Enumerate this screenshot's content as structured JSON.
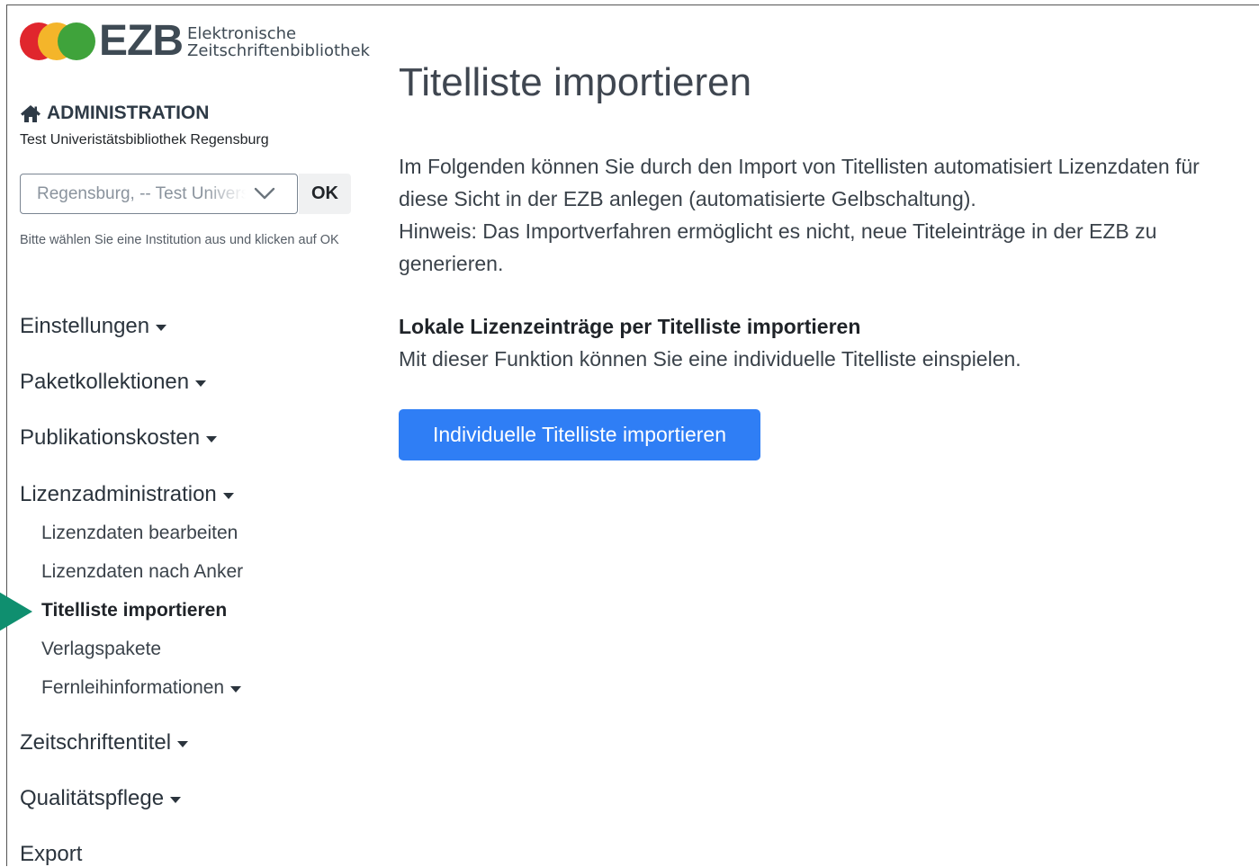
{
  "logo": {
    "wordmark": "EZB",
    "subtitle_line1": "Elektronische",
    "subtitle_line2": "Zeitschriftenbibliothek",
    "colors": [
      "#e0262d",
      "#f4b52a",
      "#3fa33b"
    ]
  },
  "sidebar": {
    "admin_title": "ADMINISTRATION",
    "institution_name": "Test Univeristätsbibliothek Regensburg",
    "institution_select_value": "Regensburg, -- Test Universitätsbibliothek Regensburg",
    "ok_label": "OK",
    "hint": "Bitte wählen Sie eine Institution aus und klicken auf OK",
    "nav": {
      "einstellungen": "Einstellungen",
      "paketkollektionen": "Paketkollektionen",
      "publikationskosten": "Publikationskosten",
      "lizenzadministration": "Lizenzadministration",
      "lizenzdaten_bearbeiten": "Lizenzdaten bearbeiten",
      "lizenzdaten_nach_anker": "Lizenzdaten nach Anker",
      "titelliste_importieren": "Titelliste importieren",
      "verlagspakete": "Verlagspakete",
      "fernleihinformationen": "Fernleihinformationen",
      "zeitschriftentitel": "Zeitschriftentitel",
      "qualitaetspflege": "Qualitätspflege",
      "export": "Export"
    },
    "active_marker_color": "#0f8f6f"
  },
  "main": {
    "title": "Titelliste importieren",
    "intro_paragraph": "Im Folgenden können Sie durch den Import von Titellisten automatisiert Lizenzdaten für diese Sicht in der EZB anlegen (automatisierte Gelbschaltung).",
    "intro_hint": "Hinweis: Das Importverfahren ermöglicht es nicht, neue Titeleinträge in der EZB zu generieren.",
    "section_title": "Lokale Lizenzeinträge per Titelliste importieren",
    "section_desc": "Mit dieser Funktion können Sie eine individuelle Titelliste einspielen.",
    "import_button": "Individuelle Titelliste importieren",
    "button_color": "#2f7ef5"
  }
}
